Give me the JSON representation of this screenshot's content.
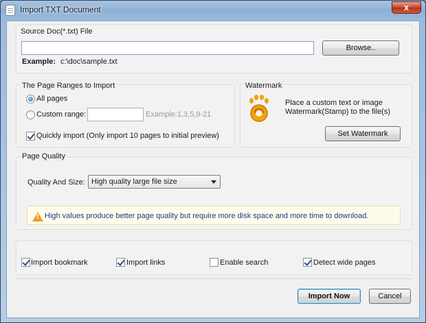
{
  "window": {
    "title": "Import TXT Document",
    "close_glyph": "x"
  },
  "source": {
    "section_title": "Source Doc(*.txt) File",
    "path_value": "",
    "browse_label": "Browse..",
    "example_label": "Example:",
    "example_value": "c:\\doc\\sample.txt"
  },
  "ranges": {
    "section_title": "The Page Ranges to Import",
    "all_pages": {
      "label": "All pages",
      "checked": true
    },
    "custom_range": {
      "label": "Custom range:",
      "checked": false,
      "value": "",
      "example": "Example:1,3,5,9-21"
    },
    "quick_import": {
      "label": "Quickly import (Only import 10 pages to  initial  preview)",
      "checked": true
    }
  },
  "watermark": {
    "section_title": "Watermark",
    "description_line1": "Place a custom text or image",
    "description_line2": "Watermark(Stamp) to the file(s)",
    "button_label": "Set Watermark",
    "icon": "gear-foot-logo"
  },
  "quality": {
    "section_title": "Page Quality",
    "size_label": "Quality And Size:",
    "selected": "High quality large file size",
    "warning": "High values produce better page quality but require more disk space and more time to download."
  },
  "options": [
    {
      "label": "Import bookmark",
      "checked": true
    },
    {
      "label": "Import links",
      "checked": true
    },
    {
      "label": "Enable search",
      "checked": false
    },
    {
      "label": "Detect wide pages",
      "checked": true
    }
  ],
  "footer": {
    "import_label": "Import Now",
    "cancel_label": "Cancel"
  },
  "colors": {
    "accent": "#1a3a8c",
    "warning_icon": "#f0a020",
    "warning_bg": "#fefbea"
  }
}
